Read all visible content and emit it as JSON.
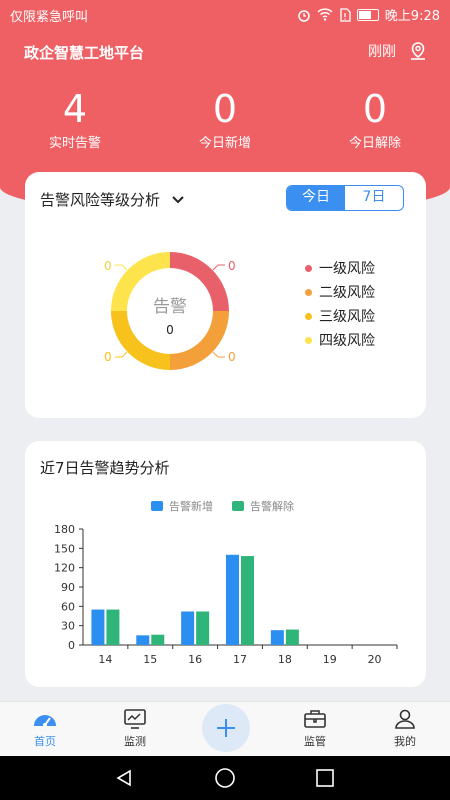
{
  "status_bar": {
    "left_text": "仅限紧急呼叫",
    "time": "晚上9:28"
  },
  "header": {
    "title": "政企智慧工地平台",
    "user_status": "刚刚"
  },
  "stats": [
    {
      "value": "4",
      "label": "实时告警"
    },
    {
      "value": "0",
      "label": "今日新增"
    },
    {
      "value": "0",
      "label": "今日解除"
    }
  ],
  "risk_card": {
    "title": "告警风险等级分析",
    "tabs": [
      "今日",
      "7日"
    ],
    "active_tab": "今日",
    "center_label": "告警",
    "center_value": "0",
    "levels": [
      {
        "name": "一级风险",
        "value": "0",
        "color": "#e8606a"
      },
      {
        "name": "二级风险",
        "value": "0",
        "color": "#f3a03a"
      },
      {
        "name": "三级风险",
        "value": "0",
        "color": "#f7c21c"
      },
      {
        "name": "四级风险",
        "value": "0",
        "color": "#fde44c"
      }
    ]
  },
  "trend_card": {
    "title": "近7日告警趋势分析"
  },
  "chart_data": {
    "type": "bar",
    "categories": [
      "14",
      "15",
      "16",
      "17",
      "18",
      "19",
      "20"
    ],
    "series": [
      {
        "name": "告警新增",
        "color": "#2a8ff0",
        "values": [
          55,
          15,
          52,
          140,
          23,
          0,
          0
        ]
      },
      {
        "name": "告警解除",
        "color": "#2fb47a",
        "values": [
          55,
          16,
          52,
          138,
          24,
          0,
          0
        ]
      }
    ],
    "yticks": [
      "0",
      "30",
      "60",
      "90",
      "120",
      "150",
      "180"
    ],
    "ylim": [
      0,
      180
    ],
    "legend": "top"
  },
  "nav": [
    {
      "label": "首页",
      "icon": "dashboard-icon"
    },
    {
      "label": "监测",
      "icon": "monitor-icon"
    },
    {
      "label": "add",
      "icon": "plus-icon"
    },
    {
      "label": "监管",
      "icon": "briefcase-icon"
    },
    {
      "label": "我的",
      "icon": "person-icon"
    }
  ]
}
